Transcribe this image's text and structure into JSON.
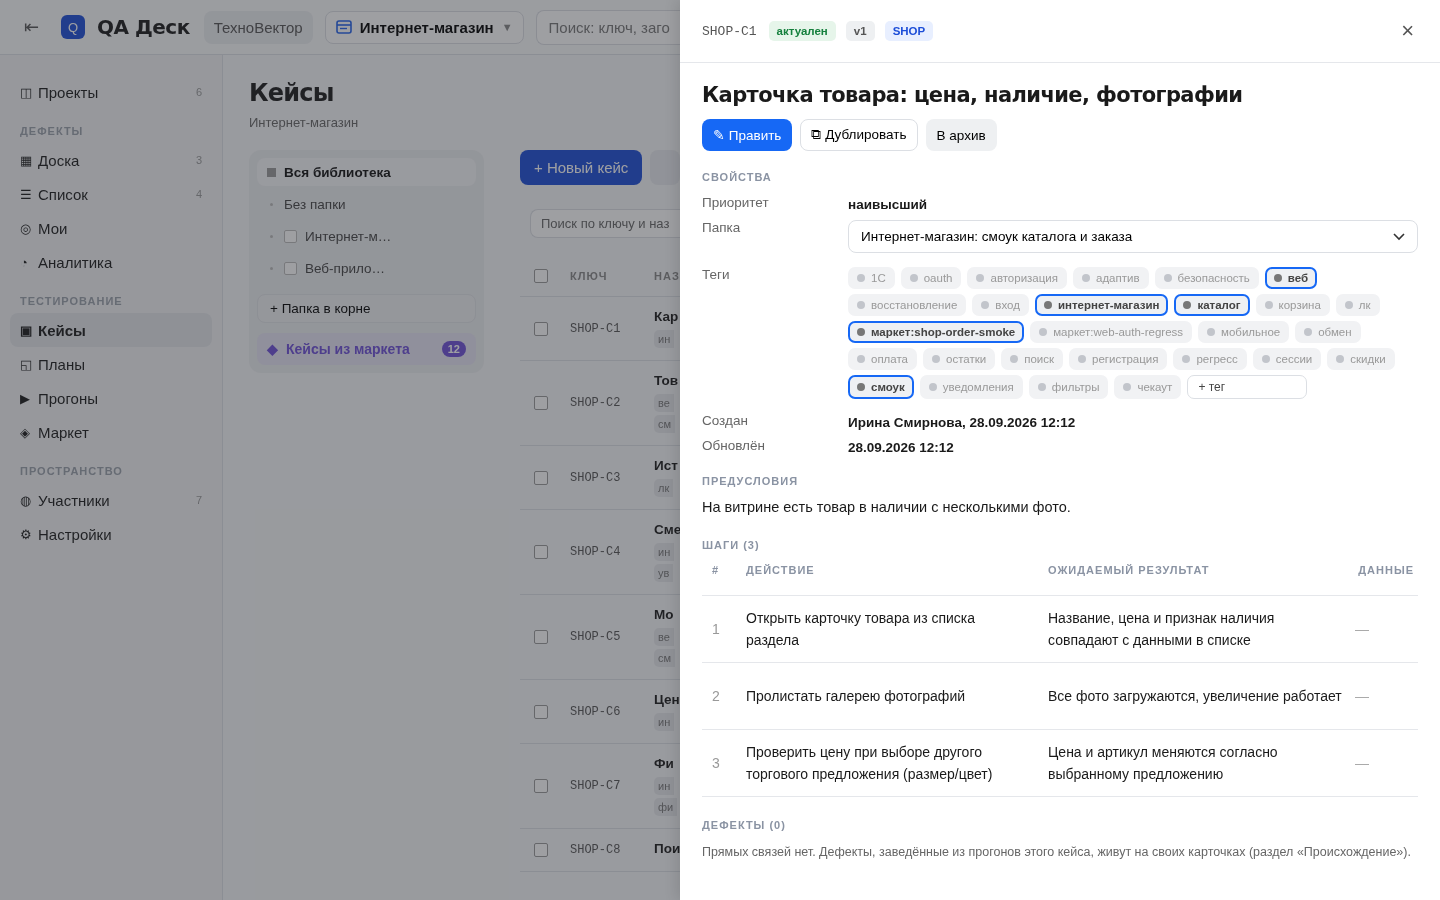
{
  "topbar": {
    "back_icon": "⇤",
    "logo_letter": "Q",
    "app_name": "QA Деск",
    "workspace": "ТехноВектор",
    "project": "Интернет-магазин",
    "project_caret": "▼",
    "search_placeholder": "Поиск: ключ, заго"
  },
  "sidebar": {
    "top": [
      {
        "icon": "◫",
        "label": "Проекты",
        "count": "6",
        "selected": false
      }
    ],
    "groups": [
      {
        "title": "ДЕФЕКТЫ",
        "items": [
          {
            "icon": "▦",
            "label": "Доска",
            "count": "3",
            "selected": false
          },
          {
            "icon": "☰",
            "label": "Список",
            "count": "4",
            "selected": false
          },
          {
            "icon": "◎",
            "label": "Мои",
            "selected": false
          },
          {
            "icon": "◔",
            "label": "Аналитика",
            "selected": false
          }
        ]
      },
      {
        "title": "ТЕСТИРОВАНИЕ",
        "items": [
          {
            "icon": "▣",
            "label": "Кейсы",
            "selected": true
          },
          {
            "icon": "◱",
            "label": "Планы",
            "selected": false
          },
          {
            "icon": "▶",
            "label": "Прогоны",
            "selected": false
          },
          {
            "icon": "◈",
            "label": "Маркет",
            "selected": false
          }
        ]
      },
      {
        "title": "ПРОСТРАНСТВО",
        "items": [
          {
            "icon": "◍",
            "label": "Участники",
            "count": "7",
            "selected": false
          },
          {
            "icon": "⚙",
            "label": "Настройки",
            "selected": false
          }
        ]
      }
    ]
  },
  "page": {
    "title": "Кейсы",
    "subtitle": "Интернет-магазин"
  },
  "folders": {
    "items": [
      {
        "kind": "all",
        "label": "Вся библиотека",
        "selected": true
      },
      {
        "kind": "plain",
        "label": "Без папки",
        "selected": false
      },
      {
        "kind": "folder",
        "label": "Интернет-м…",
        "selected": false
      },
      {
        "kind": "folder",
        "label": "Веб-прило…",
        "selected": false
      }
    ],
    "add_button": "+ Папка в корне",
    "market": {
      "icon": "◆",
      "label": "Кейсы из маркета",
      "count": "12"
    }
  },
  "cases": {
    "new_button": "+ Новый кейс",
    "select_all_checked": false,
    "search_placeholder": "Поиск по ключу и наз",
    "columns": [
      "КЛЮЧ",
      "НАЗ"
    ],
    "rows": [
      {
        "checked": false,
        "key": "SHOP-C1",
        "title": "Кар",
        "tags": [
          "ин"
        ]
      },
      {
        "checked": false,
        "key": "SHOP-C2",
        "title": "Тов",
        "tags": [
          "ве",
          "см"
        ]
      },
      {
        "checked": false,
        "key": "SHOP-C3",
        "title": "Ист",
        "tags": [
          "лк"
        ]
      },
      {
        "checked": false,
        "key": "SHOP-C4",
        "title": "Сме",
        "tags": [
          "ин",
          "ув"
        ]
      },
      {
        "checked": false,
        "key": "SHOP-C5",
        "title": "Мо",
        "tags": [
          "ве",
          "см"
        ]
      },
      {
        "checked": false,
        "key": "SHOP-C6",
        "title": "Цен",
        "tags": [
          "ин"
        ]
      },
      {
        "checked": false,
        "key": "SHOP-C7",
        "title": "Фи",
        "tags": [
          "ин",
          "фи"
        ]
      },
      {
        "checked": false,
        "key": "SHOP-C8",
        "title": "Пои",
        "tags": []
      }
    ]
  },
  "drawer": {
    "key": "SHOP-C1",
    "badges": [
      {
        "kind": "status",
        "text": "актуален"
      },
      {
        "kind": "version",
        "text": "v1"
      },
      {
        "kind": "project",
        "text": "SHOP"
      }
    ],
    "close": "×",
    "title": "Карточка товара: цена, наличие, фотографии",
    "actions": [
      {
        "kind": "primary",
        "text": "✎ Править"
      },
      {
        "kind": "outline",
        "text": "⧉ Дублировать"
      },
      {
        "kind": "soft",
        "text": "В архив"
      }
    ],
    "properties_title": "СВОЙСТВА",
    "priority": {
      "label": "Приоритет",
      "value": "наивысший"
    },
    "folder": {
      "label": "Папка",
      "value": "Интернет-магазин: смоук каталога и заказа"
    },
    "tags_label": "Теги",
    "tags": [
      {
        "text": "1С",
        "selected": false
      },
      {
        "text": "oauth",
        "selected": false
      },
      {
        "text": "авторизация",
        "selected": false
      },
      {
        "text": "адаптив",
        "selected": false
      },
      {
        "text": "безопасность",
        "selected": false
      },
      {
        "text": "веб",
        "selected": true
      },
      {
        "text": "восстановление",
        "selected": false
      },
      {
        "text": "вход",
        "selected": false
      },
      {
        "text": "интернет-магазин",
        "selected": true
      },
      {
        "text": "каталог",
        "selected": true
      },
      {
        "text": "корзина",
        "selected": false
      },
      {
        "text": "лк",
        "selected": false
      },
      {
        "text": "маркет:shop-order-smoke",
        "selected": true
      },
      {
        "text": "маркет:web-auth-regress",
        "selected": false
      },
      {
        "text": "мобильное",
        "selected": false
      },
      {
        "text": "обмен",
        "selected": false
      },
      {
        "text": "оплата",
        "selected": false
      },
      {
        "text": "остатки",
        "selected": false
      },
      {
        "text": "поиск",
        "selected": false
      },
      {
        "text": "регистрация",
        "selected": false
      },
      {
        "text": "регресс",
        "selected": false
      },
      {
        "text": "сессии",
        "selected": false
      },
      {
        "text": "скидки",
        "selected": false
      },
      {
        "text": "смоук",
        "selected": true
      },
      {
        "text": "уведомления",
        "selected": false
      },
      {
        "text": "фильтры",
        "selected": false
      },
      {
        "text": "чекаут",
        "selected": false
      }
    ],
    "tag_placeholder": "+ тег",
    "created": {
      "label": "Создан",
      "value": "Ирина Смирнова, 28.09.2026 12:12"
    },
    "updated": {
      "label": "Обновлён",
      "value": "28.09.2026 12:12"
    },
    "preconditions_title": "ПРЕДУСЛОВИЯ",
    "preconditions": "На витрине есть товар в наличии с несколькими фото.",
    "steps_title": "ШАГИ (3)",
    "step_columns": [
      "#",
      "ДЕЙСТВИЕ",
      "ОЖИДАЕМЫЙ РЕЗУЛЬТАТ",
      "ДАННЫЕ"
    ],
    "steps": [
      {
        "n": "1",
        "action": "Открыть карточку товара из списка раздела",
        "expected": "Название, цена и признак наличия совпадают с данными в списке",
        "data": "—"
      },
      {
        "n": "2",
        "action": "Пролистать галерею фотографий",
        "expected": "Все фото загружаются, увеличение работает",
        "data": "—"
      },
      {
        "n": "3",
        "action": "Проверить цену при выборе другого торгового предложения (размер/цвет)",
        "expected": "Цена и артикул меняются согласно выбранному предложению",
        "data": "—"
      }
    ],
    "defects_title": "ДЕФЕКТЫ (0)",
    "defects_text": "Прямых связей нет. Дефекты, заведённые из прогонов этого кейса, живут на своих карточках (раздел «Происхождение»)."
  }
}
